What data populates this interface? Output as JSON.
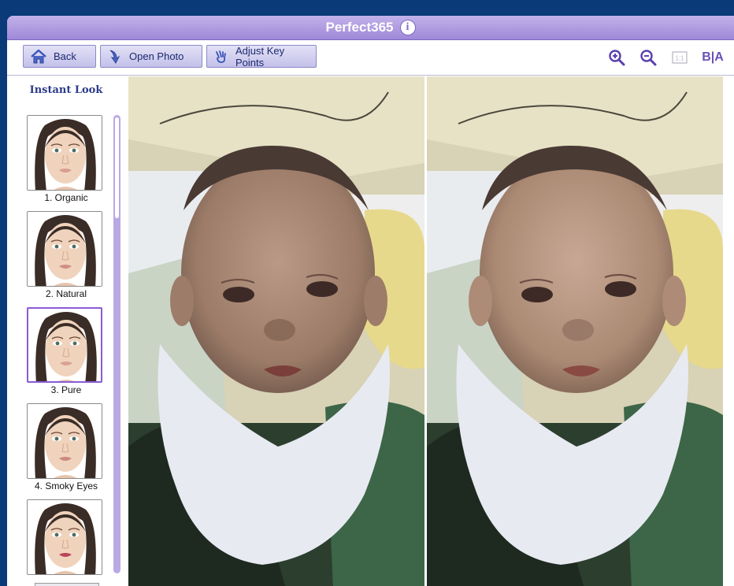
{
  "window": {
    "title": "Perfect365"
  },
  "toolbar": {
    "back_label": "Back",
    "open_photo_label": "Open Photo",
    "adjust_key_points_label": "Adjust Key Points",
    "ba_label": "B|A"
  },
  "sidebar": {
    "title": "Instant Look",
    "items": [
      {
        "label": "1. Organic",
        "lip_color": "#d99c90"
      },
      {
        "label": "2. Natural",
        "lip_color": "#cf8f86"
      },
      {
        "label": "3. Pure",
        "lip_color": "#d9a197",
        "selected": true
      },
      {
        "label": "4. Smoky Eyes",
        "lip_color": "#c98a80"
      },
      {
        "label": "",
        "lip_color": "#b9465a"
      }
    ]
  },
  "colors": {
    "accent": "#9f88d8",
    "window_bg": "#0b3a78",
    "selected_border": "#8a5bd6"
  },
  "icons": {
    "back": "home-icon",
    "open_photo": "arrow-down-icon",
    "adjust_key_points": "hand-icon",
    "zoom_in": "zoom-in-icon",
    "zoom_out": "zoom-out-icon",
    "actual_size": "actual-size-icon",
    "info": "info-icon"
  }
}
